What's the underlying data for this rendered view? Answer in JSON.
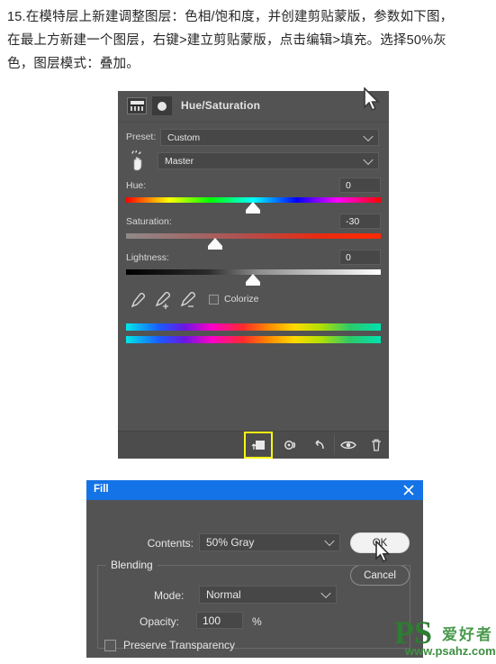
{
  "instructions": {
    "line1": "15.在模特层上新建调整图层：色相/饱和度，并创建剪贴蒙版，参数如下图，",
    "line2": "在最上方新建一个图层，右键>建立剪贴蒙版，点击编辑>填充。选择50%灰",
    "line3": "色，图层模式：叠加。"
  },
  "hue_saturation_panel": {
    "title": "Hue/Saturation",
    "preset": {
      "label": "Preset:",
      "value": "Custom"
    },
    "channel": {
      "value": "Master"
    },
    "sliders": [
      {
        "label": "Hue:",
        "value": "0",
        "thumb_pct": 50
      },
      {
        "label": "Saturation:",
        "value": "-30",
        "thumb_pct": 35
      },
      {
        "label": "Lightness:",
        "value": "0",
        "thumb_pct": 50
      }
    ],
    "colorize": {
      "label": "Colorize",
      "checked": false
    },
    "eyedroppers": [
      "eyedropper",
      "eyedropper-plus",
      "eyedropper-minus"
    ],
    "toolbar": {
      "clip_to_layer": "clip-to-layer",
      "toggle_visibility": "toggle-previous-state",
      "reset": "reset",
      "eye": "view",
      "delete": "delete",
      "highlight_color": "#f6f615"
    }
  },
  "fill_dialog": {
    "title": "Fill",
    "close": "×",
    "contents": {
      "label": "Contents:",
      "value": "50% Gray"
    },
    "ok": "OK",
    "cancel": "Cancel",
    "blending": {
      "legend": "Blending",
      "mode": {
        "label": "Mode:",
        "value": "Normal"
      },
      "opacity": {
        "label": "Opacity:",
        "value": "100",
        "unit": "%"
      },
      "preserve": {
        "label": "Preserve Transparency",
        "checked": false
      }
    },
    "title_bar_color": "#1473e6"
  },
  "watermark": {
    "logo": "PS",
    "cn": "爱好者",
    "url": "www.psahz.com",
    "color": "#3f8f42"
  }
}
